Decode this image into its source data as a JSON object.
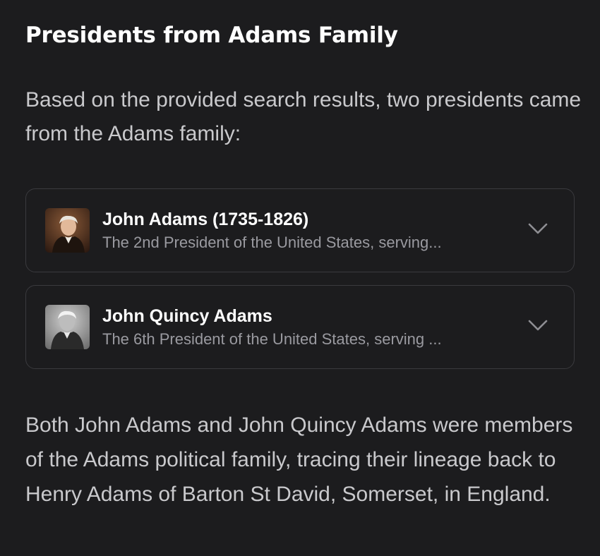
{
  "heading": "Presidents from Adams Family",
  "intro": "Based on the provided search results, two presidents came from the Adams family:",
  "cards": [
    {
      "title": "John Adams (1735-1826)",
      "subtitle": "The 2nd President of the United States, serving...",
      "thumbnail": "portrait-john-adams"
    },
    {
      "title": "John Quincy Adams",
      "subtitle": "The 6th President of the United States, serving ...",
      "thumbnail": "portrait-john-quincy-adams"
    }
  ],
  "outro": "Both John Adams and John Quincy Adams were members of the Adams political family, tracing their lineage back to Henry Adams of Barton St David, Somerset, in England.",
  "colors": {
    "background": "#1c1c1e",
    "card_border": "#3a3a3e",
    "title": "#ffffff",
    "body_text": "#c9c9cc",
    "muted_text": "#9a9aa0",
    "chevron": "#8e8e93"
  }
}
